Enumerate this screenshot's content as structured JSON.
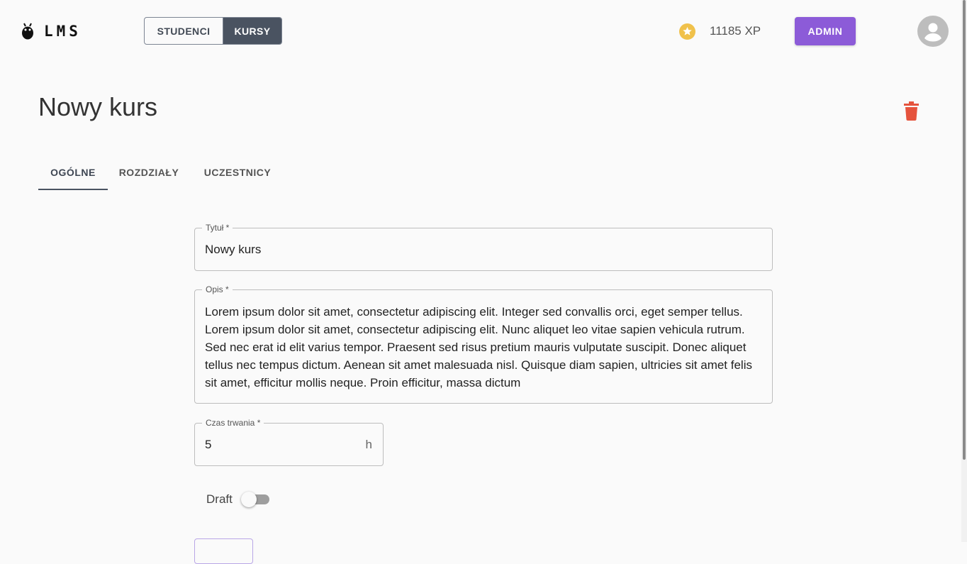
{
  "app": {
    "logo_text": "LMS"
  },
  "nav": {
    "toggle": [
      {
        "label": "STUDENCI"
      },
      {
        "label": "KURSY"
      }
    ]
  },
  "header": {
    "xp": "11185 XP",
    "admin_label": "ADMIN"
  },
  "page": {
    "title": "Nowy kurs"
  },
  "tabs": [
    {
      "label": "OGÓLNE"
    },
    {
      "label": "ROZDZIAŁY"
    },
    {
      "label": "UCZESTNICY"
    }
  ],
  "form": {
    "title": {
      "label": "Tytuł *",
      "value": "Nowy kurs"
    },
    "description": {
      "label": "Opis *",
      "value": "Lorem ipsum dolor sit amet, consectetur adipiscing elit. Integer sed convallis orci, eget semper tellus. Lorem ipsum dolor sit amet, consectetur adipiscing elit. Nunc aliquet leo vitae sapien vehicula rutrum. Sed nec erat id elit varius tempor. Praesent sed risus pretium mauris vulputate suscipit. Donec aliquet tellus nec tempus dictum. Aenean sit amet malesuada nisl. Quisque diam sapien, ultricies sit amet felis sit amet, efficitur mollis neque. Proin efficitur, massa dictum"
    },
    "duration": {
      "label": "Czas trwania *",
      "value": "5",
      "unit": "h"
    },
    "draft": {
      "label": "Draft",
      "checked": false
    }
  },
  "colors": {
    "accent": "#8c5bd8",
    "dark": "#4a5361",
    "danger": "#e5533d",
    "star": "#f0c14b"
  },
  "icons": {
    "logo": "bug-icon",
    "xp": "star-icon",
    "avatar": "account-circle-icon",
    "delete": "trash-icon"
  }
}
